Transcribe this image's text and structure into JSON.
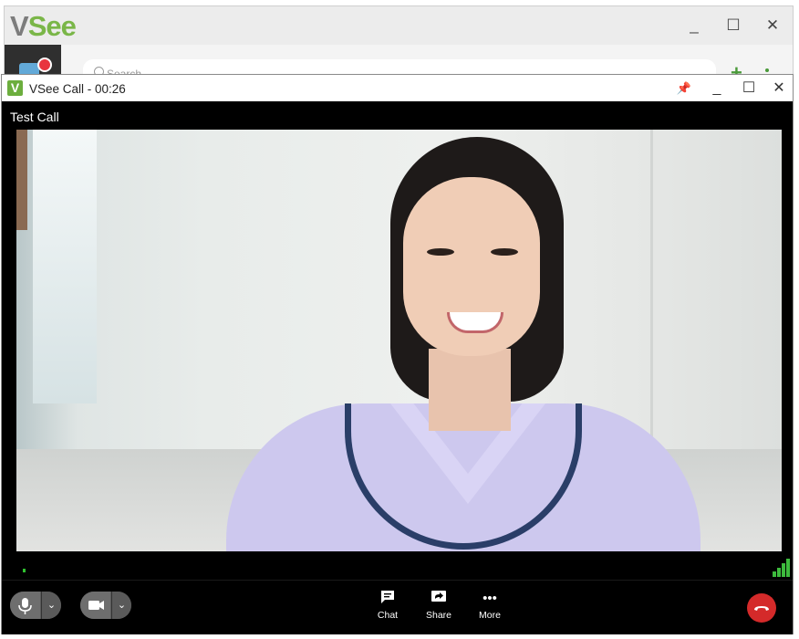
{
  "app": {
    "logo_v": "V",
    "logo_see": "See",
    "controls": {
      "minimize": "_",
      "maximize": "☐",
      "close": "✕"
    },
    "search_placeholder": "Search",
    "add_label": "+"
  },
  "call": {
    "logo_letter": "V",
    "window_title": "VSee Call - 00:26",
    "controls": {
      "pin": "📌",
      "minimize": "_",
      "maximize": "☐",
      "close": "✕"
    },
    "participant_name": "Test Call"
  },
  "toolbar": {
    "chat_label": "Chat",
    "share_label": "Share",
    "more_label": "More",
    "more_icon": "•••",
    "caret": "⌄"
  },
  "colors": {
    "brand_green": "#7ab648",
    "hangup_red": "#d42a2a",
    "signal_green": "#3dbb3d"
  }
}
